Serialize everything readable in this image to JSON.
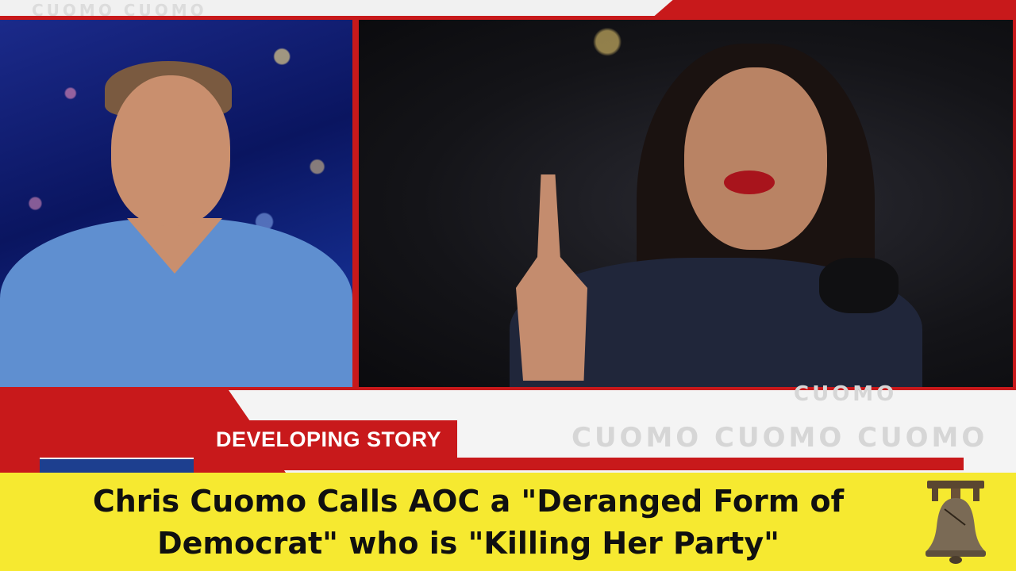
{
  "top_strip": {
    "ghost_text": "CUOMO CUOMO"
  },
  "lower_third": {
    "label": "DEVELOPING STORY",
    "ghost_text_upper": "CUOMO",
    "ghost_text_lower": "CUOMO CUOMO CUOMO"
  },
  "title": "Chris Cuomo Calls AOC a \"Deranged Form of Democrat\" who is \"Killing Her Party\"",
  "icons": {
    "logo": "liberty-bell-icon"
  },
  "colors": {
    "accent_red": "#c8191b",
    "banner_yellow": "#f6e930",
    "lower_blue": "#1d3f8f"
  }
}
